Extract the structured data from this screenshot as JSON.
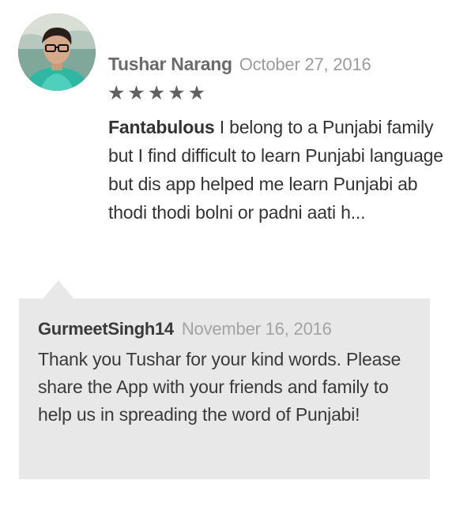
{
  "review": {
    "author": "Tushar Narang",
    "date": "October 27, 2016",
    "rating": 5,
    "stars": [
      "★",
      "★",
      "★",
      "★",
      "★"
    ],
    "title": "Fantabulous",
    "text": "I belong to a Punjabi family but I find difficult to learn Punjabi language but dis app helped me learn Punjabi ab thodi thodi bolni or padni aati h..."
  },
  "reply": {
    "author": "GurmeetSingh14",
    "date": "November 16, 2016",
    "text": "Thank you Tushar for your kind words. Please share the App with your friends and family to help us in spreading the word of Punjabi!"
  },
  "colors": {
    "reply_background": "#e8e8e8",
    "star": "#616161"
  },
  "icons": {
    "avatar": "user-avatar",
    "star": "star-icon"
  }
}
